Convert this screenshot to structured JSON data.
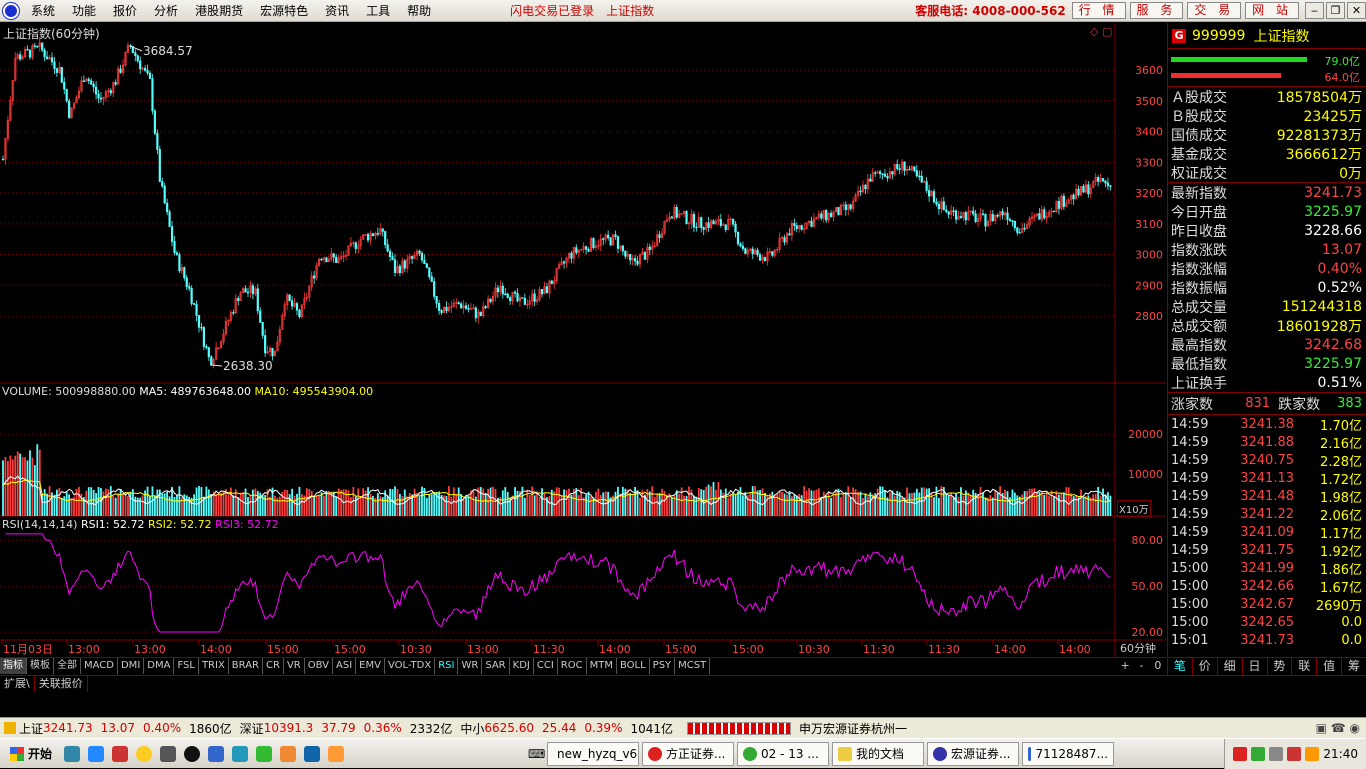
{
  "menubar": {
    "items": [
      "系统",
      "功能",
      "报价",
      "分析",
      "港股期货",
      "宏源特色",
      "资讯",
      "工具",
      "帮助"
    ],
    "status": "闪电交易已登录",
    "index_link": "上证指数",
    "hotline": "客服电话: 4008-000-562",
    "buttons": [
      "行 情",
      "服 务",
      "交 易",
      "网 站"
    ]
  },
  "chart": {
    "title": "上证指数(60分钟)",
    "high_label": "3684.57",
    "low_label": "2638.30",
    "price_ticks": [
      "3600",
      "3500",
      "3400",
      "3300",
      "3200",
      "3100",
      "3000",
      "2900",
      "2800"
    ],
    "volume_header": {
      "vol": "VOLUME: 500998880.00",
      "ma5": "MA5: 489763648.00",
      "ma10": "MA10: 495543904.00"
    },
    "volume_ticks": [
      "20000",
      "10000"
    ],
    "volume_unit": "X10万",
    "rsi_header": {
      "name": "RSI(14,14,14)",
      "rsi1": "RSI1: 52.72",
      "rsi2": "RSI2: 52.72",
      "rsi3": "RSI3: 52.72"
    },
    "rsi_ticks": [
      "80.00",
      "50.00",
      "20.00"
    ],
    "time_labels": [
      "11月03日",
      "13:00",
      "13:00",
      "14:00",
      "15:00",
      "15:00",
      "10:30",
      "13:00",
      "11:30",
      "14:00",
      "15:00",
      "15:00",
      "10:30",
      "11:30",
      "11:30",
      "14:00",
      "14:00"
    ],
    "period": "60分钟",
    "colors": {
      "up": "#ff3c3c",
      "down": "#55ffff",
      "rsi": "#ff00ff",
      "ma5": "#ffffff",
      "ma10": "#ffff00",
      "grid": "#800000"
    }
  },
  "indicator_tabs": [
    "指标",
    "模板",
    "全部",
    "MACD",
    "DMI",
    "DMA",
    "FSL",
    "TRIX",
    "BRAR",
    "CR",
    "VR",
    "OBV",
    "ASI",
    "EMV",
    "VOL-TDX",
    "RSI",
    "WR",
    "SAR",
    "KDJ",
    "CCI",
    "ROC",
    "MTM",
    "BOLL",
    "PSY",
    "MCST"
  ],
  "zoom_controls": [
    "+",
    "-",
    "0"
  ],
  "ext_tabs": [
    "扩展\\",
    "关联报价"
  ],
  "right": {
    "code": "999999",
    "name": "上证指数",
    "bar_top_value": "79.0亿",
    "bar_bottom_value": "64.0亿",
    "market_rows": [
      {
        "k": "Ａ股成交",
        "v": "18578504万"
      },
      {
        "k": "Ｂ股成交",
        "v": "23425万"
      },
      {
        "k": "国债成交",
        "v": "92281373万"
      },
      {
        "k": "基金成交",
        "v": "3666612万"
      },
      {
        "k": "权证成交",
        "v": "0万"
      }
    ],
    "quote_rows": [
      {
        "k": "最新指数",
        "v": "3241.73",
        "c": "#ff4444"
      },
      {
        "k": "今日开盘",
        "v": "3225.97",
        "c": "#33ee33"
      },
      {
        "k": "昨日收盘",
        "v": "3228.66",
        "c": "#ffffff"
      },
      {
        "k": "指数涨跌",
        "v": "13.07",
        "c": "#ff4444"
      },
      {
        "k": "指数涨幅",
        "v": "0.40%",
        "c": "#ff4444"
      },
      {
        "k": "指数振幅",
        "v": "0.52%",
        "c": "#ffffff"
      },
      {
        "k": "总成交量",
        "v": "151244318",
        "c": "#ffff00"
      },
      {
        "k": "总成交额",
        "v": "18601928万",
        "c": "#ffff00"
      },
      {
        "k": "最高指数",
        "v": "3242.68",
        "c": "#ff4444"
      },
      {
        "k": "最低指数",
        "v": "3225.97",
        "c": "#33ee33"
      },
      {
        "k": "上证换手",
        "v": "0.51%",
        "c": "#ffffff"
      }
    ],
    "updown": {
      "up_label": "涨家数",
      "up": "831",
      "down_label": "跌家数",
      "down": "383"
    },
    "ticks": [
      {
        "t": "14:59",
        "p": "3241.38",
        "v": "1.70亿"
      },
      {
        "t": "14:59",
        "p": "3241.88",
        "v": "2.16亿"
      },
      {
        "t": "14:59",
        "p": "3240.75",
        "v": "2.28亿"
      },
      {
        "t": "14:59",
        "p": "3241.13",
        "v": "1.72亿"
      },
      {
        "t": "14:59",
        "p": "3241.48",
        "v": "1.98亿"
      },
      {
        "t": "14:59",
        "p": "3241.22",
        "v": "2.06亿"
      },
      {
        "t": "14:59",
        "p": "3241.09",
        "v": "1.17亿"
      },
      {
        "t": "14:59",
        "p": "3241.75",
        "v": "1.92亿"
      },
      {
        "t": "15:00",
        "p": "3241.99",
        "v": "1.86亿"
      },
      {
        "t": "15:00",
        "p": "3242.66",
        "v": "1.67亿"
      },
      {
        "t": "15:00",
        "p": "3242.67",
        "v": "2690万"
      },
      {
        "t": "15:00",
        "p": "3242.65",
        "v": "0.0"
      },
      {
        "t": "15:01",
        "p": "3241.73",
        "v": "0.0"
      }
    ],
    "tabs": [
      "笔",
      "价",
      "细",
      "日",
      "势",
      "联",
      "值",
      "筹"
    ]
  },
  "infobar": {
    "sh_name": "上证",
    "sh_val": "3241.73",
    "sh_chg": "13.07",
    "sh_pct": "0.40%",
    "sh_amt": "1860亿",
    "sz_name": "深证",
    "sz_val": "10391.3",
    "sz_chg": "37.79",
    "sz_pct": "0.36%",
    "sz_amt": "2332亿",
    "zx_name": "中小",
    "zx_val": "6625.60",
    "zx_chg": "25.44",
    "zx_pct": "0.39%",
    "zx_amt": "1041亿",
    "broker": "申万宏源证券杭州一"
  },
  "taskbar": {
    "start": "开始",
    "tasks": [
      "new_hyzq_v6",
      "方正证券...",
      "02 - 13 ...",
      "我的文档",
      "宏源证券...",
      "71128487..."
    ],
    "clock": "21:40"
  }
}
